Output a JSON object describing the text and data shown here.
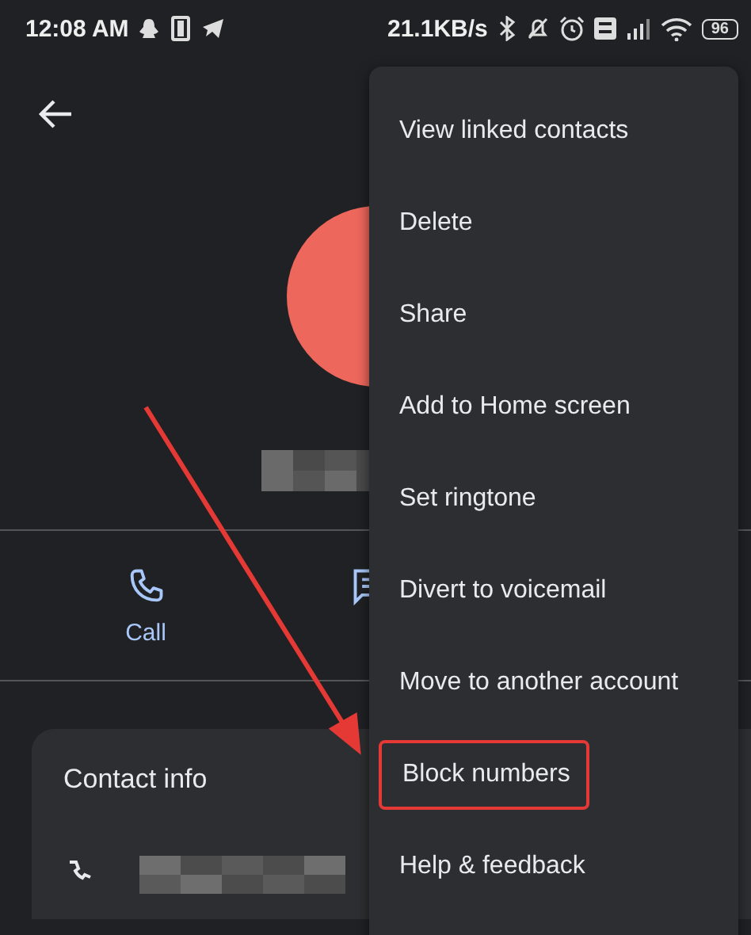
{
  "status_bar": {
    "time": "12:08 AM",
    "speed": "21.1KB/s",
    "battery": "96"
  },
  "actions": [
    {
      "kind": "call",
      "label": "Call"
    },
    {
      "kind": "text"
    }
  ],
  "contact_info": {
    "title": "Contact info"
  },
  "menu": {
    "items": [
      {
        "label": "View linked contacts",
        "highlighted": false
      },
      {
        "label": "Delete",
        "highlighted": false
      },
      {
        "label": "Share",
        "highlighted": false
      },
      {
        "label": "Add to Home screen",
        "highlighted": false
      },
      {
        "label": "Set ringtone",
        "highlighted": false
      },
      {
        "label": "Divert to voicemail",
        "highlighted": false
      },
      {
        "label": "Move to another account",
        "highlighted": false
      },
      {
        "label": "Block numbers",
        "highlighted": true
      },
      {
        "label": "Help & feedback",
        "highlighted": false
      }
    ]
  }
}
